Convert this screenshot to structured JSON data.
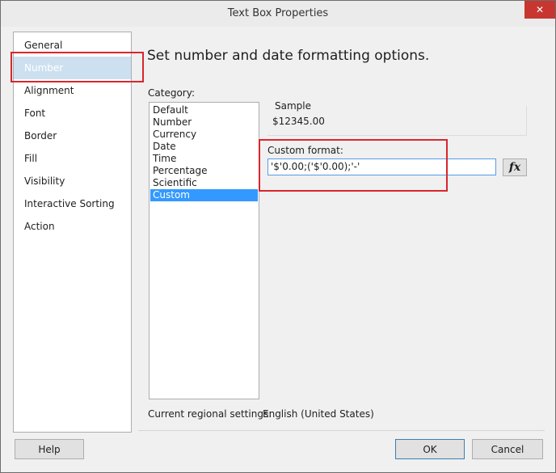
{
  "window": {
    "title": "Text Box Properties",
    "close_glyph": "✕"
  },
  "nav": {
    "items": [
      {
        "label": "General"
      },
      {
        "label": "Number"
      },
      {
        "label": "Alignment"
      },
      {
        "label": "Font"
      },
      {
        "label": "Border"
      },
      {
        "label": "Fill"
      },
      {
        "label": "Visibility"
      },
      {
        "label": "Interactive Sorting"
      },
      {
        "label": "Action"
      }
    ],
    "selected": "Number"
  },
  "main": {
    "heading": "Set number and date formatting options.",
    "category_label": "Category:",
    "categories": [
      "Default",
      "Number",
      "Currency",
      "Date",
      "Time",
      "Percentage",
      "Scientific",
      "Custom"
    ],
    "selected_category": "Custom",
    "sample_label": "Sample",
    "sample_value": "$12345.00",
    "custom_format_label": "Custom format:",
    "custom_format_value": "'$'0.00;('$'0.00);'-'",
    "fx_label": "fx",
    "regional_label": "Current regional settings:",
    "regional_value": "English (United States)"
  },
  "footer": {
    "help_label": "Help",
    "ok_label": "OK",
    "cancel_label": "Cancel"
  },
  "colors": {
    "highlight": "#d9262e",
    "list_selection": "#3399ff",
    "close_button": "#c7372f"
  }
}
